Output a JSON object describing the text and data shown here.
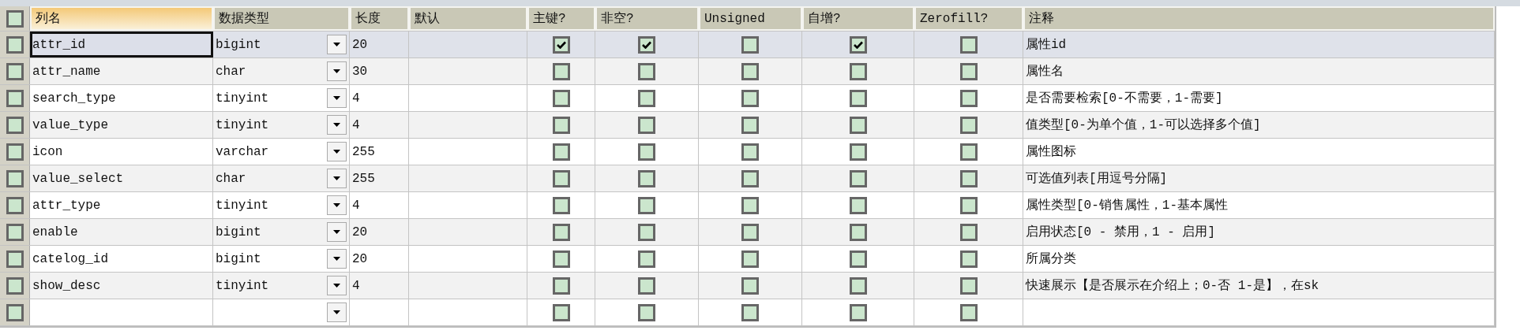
{
  "header_checked": false,
  "columns": [
    {
      "label": "列名",
      "selected": true
    },
    {
      "label": "数据类型",
      "selected": false
    },
    {
      "label": "长度",
      "selected": false
    },
    {
      "label": "默认",
      "selected": false
    },
    {
      "label": "主键?",
      "selected": false
    },
    {
      "label": "非空?",
      "selected": false
    },
    {
      "label": "Unsigned",
      "selected": false
    },
    {
      "label": "自增?",
      "selected": false
    },
    {
      "label": "Zerofill?",
      "selected": false
    },
    {
      "label": "注释",
      "selected": false
    }
  ],
  "rows": [
    {
      "row_checked": false,
      "selected": true,
      "name_focused": true,
      "name": "attr_id",
      "type": "bigint",
      "length": "20",
      "primary_key": true,
      "not_null": true,
      "unsigned": false,
      "auto_increment": true,
      "zerofill": false,
      "comment": "属性id"
    },
    {
      "row_checked": false,
      "selected": false,
      "name_focused": false,
      "name": "attr_name",
      "type": "char",
      "length": "30",
      "primary_key": false,
      "not_null": false,
      "unsigned": false,
      "auto_increment": false,
      "zerofill": false,
      "comment": "属性名"
    },
    {
      "row_checked": false,
      "selected": false,
      "name_focused": false,
      "name": "search_type",
      "type": "tinyint",
      "length": "4",
      "primary_key": false,
      "not_null": false,
      "unsigned": false,
      "auto_increment": false,
      "zerofill": false,
      "comment": "是否需要检索[0-不需要，1-需要]"
    },
    {
      "row_checked": false,
      "selected": false,
      "name_focused": false,
      "name": "value_type",
      "type": "tinyint",
      "length": "4",
      "primary_key": false,
      "not_null": false,
      "unsigned": false,
      "auto_increment": false,
      "zerofill": false,
      "comment": "值类型[0-为单个值，1-可以选择多个值]"
    },
    {
      "row_checked": false,
      "selected": false,
      "name_focused": false,
      "name": "icon",
      "type": "varchar",
      "length": "255",
      "primary_key": false,
      "not_null": false,
      "unsigned": false,
      "auto_increment": false,
      "zerofill": false,
      "comment": "属性图标"
    },
    {
      "row_checked": false,
      "selected": false,
      "name_focused": false,
      "name": "value_select",
      "type": "char",
      "length": "255",
      "primary_key": false,
      "not_null": false,
      "unsigned": false,
      "auto_increment": false,
      "zerofill": false,
      "comment": "可选值列表[用逗号分隔]"
    },
    {
      "row_checked": false,
      "selected": false,
      "name_focused": false,
      "name": "attr_type",
      "type": "tinyint",
      "length": "4",
      "primary_key": false,
      "not_null": false,
      "unsigned": false,
      "auto_increment": false,
      "zerofill": false,
      "comment": "属性类型[0-销售属性，1-基本属性"
    },
    {
      "row_checked": false,
      "selected": false,
      "name_focused": false,
      "name": "enable",
      "type": "bigint",
      "length": "20",
      "primary_key": false,
      "not_null": false,
      "unsigned": false,
      "auto_increment": false,
      "zerofill": false,
      "comment": "启用状态[0 - 禁用，1 - 启用]"
    },
    {
      "row_checked": false,
      "selected": false,
      "name_focused": false,
      "name": "catelog_id",
      "type": "bigint",
      "length": "20",
      "primary_key": false,
      "not_null": false,
      "unsigned": false,
      "auto_increment": false,
      "zerofill": false,
      "comment": "所属分类"
    },
    {
      "row_checked": false,
      "selected": false,
      "name_focused": false,
      "name": "show_desc",
      "type": "tinyint",
      "length": "4",
      "primary_key": false,
      "not_null": false,
      "unsigned": false,
      "auto_increment": false,
      "zerofill": false,
      "comment": "快速展示【是否展示在介绍上；0-否 1-是】，在sk"
    },
    {
      "row_checked": false,
      "selected": false,
      "name_focused": false,
      "primary_key": false,
      "not_null": false,
      "unsigned": false,
      "auto_increment": false,
      "zerofill": false
    }
  ]
}
